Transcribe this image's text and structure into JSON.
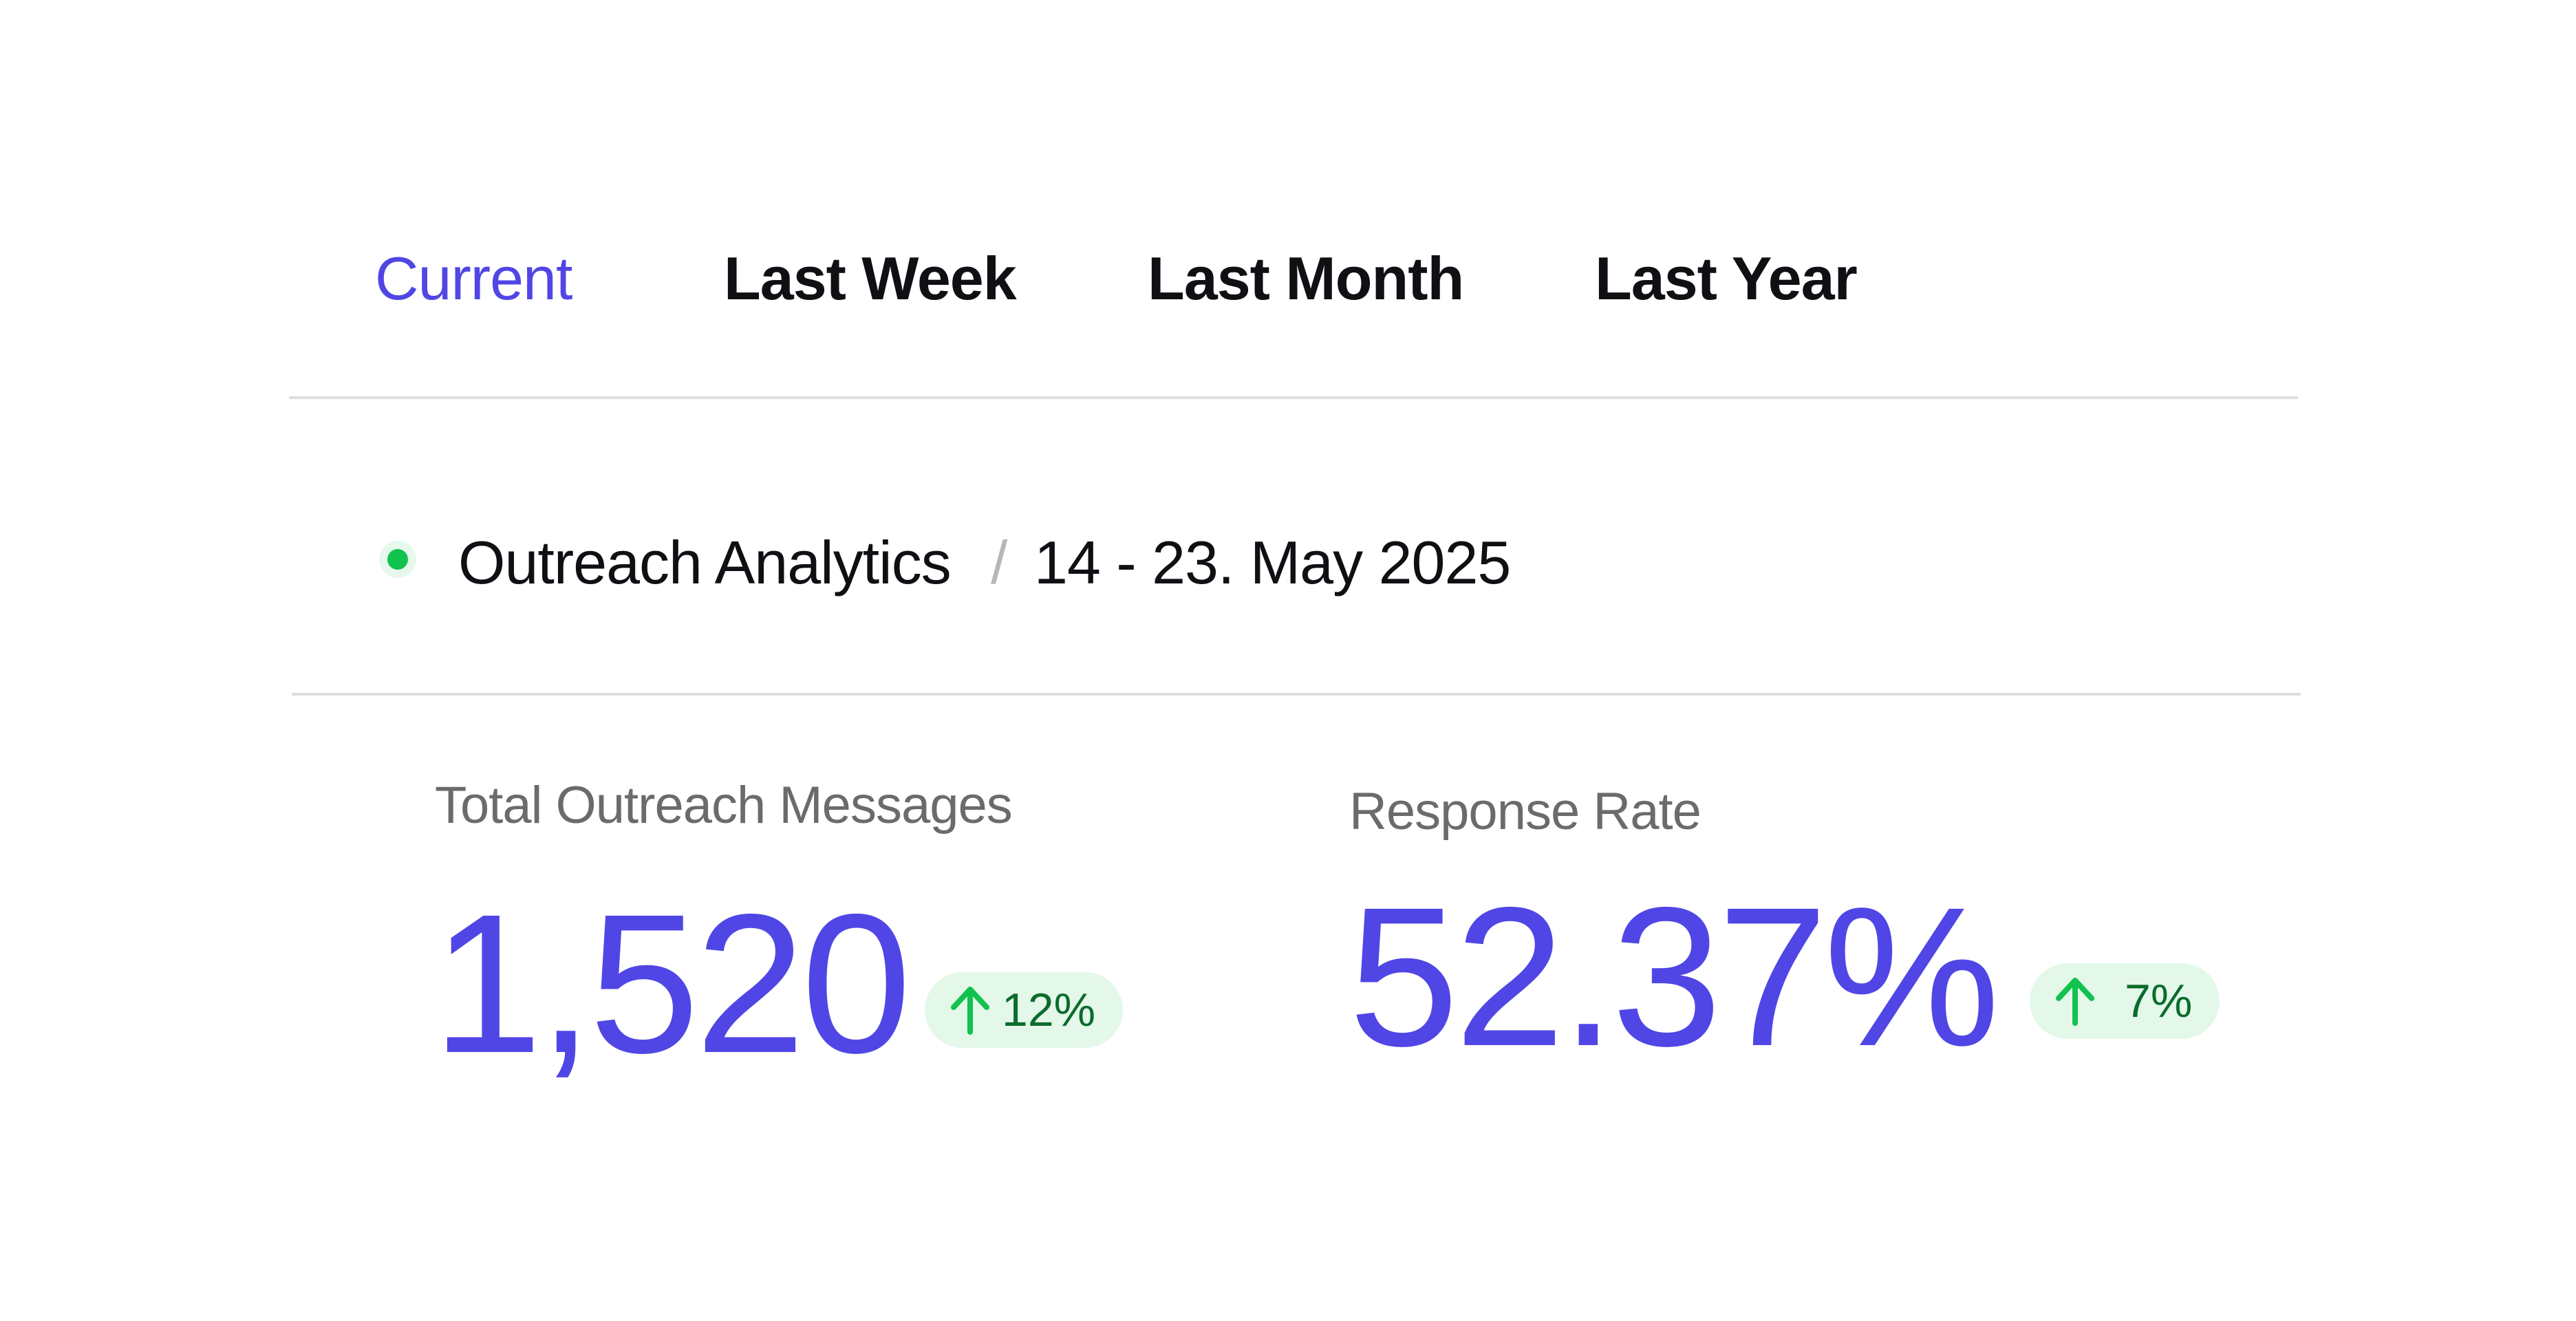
{
  "tabs": [
    {
      "label": "Current",
      "active": true
    },
    {
      "label": "Last Week",
      "active": false
    },
    {
      "label": "Last Month",
      "active": false
    },
    {
      "label": "Last Year",
      "active": false
    }
  ],
  "header": {
    "title": "Outreach Analytics",
    "separator": "/",
    "date_range": "14 - 23. May 2025",
    "status_color": "#12c24f"
  },
  "metrics": [
    {
      "label": "Total Outreach Messages",
      "value": "1,520",
      "change": "12%",
      "trend": "up"
    },
    {
      "label": "Response Rate",
      "value": "52.37%",
      "change": "7%",
      "trend": "up"
    }
  ],
  "colors": {
    "accent": "#5046e5",
    "positive": "#12c24f",
    "positive_bg": "#e3f8e9",
    "text": "#0f0f14",
    "muted": "#6b6b6b"
  }
}
